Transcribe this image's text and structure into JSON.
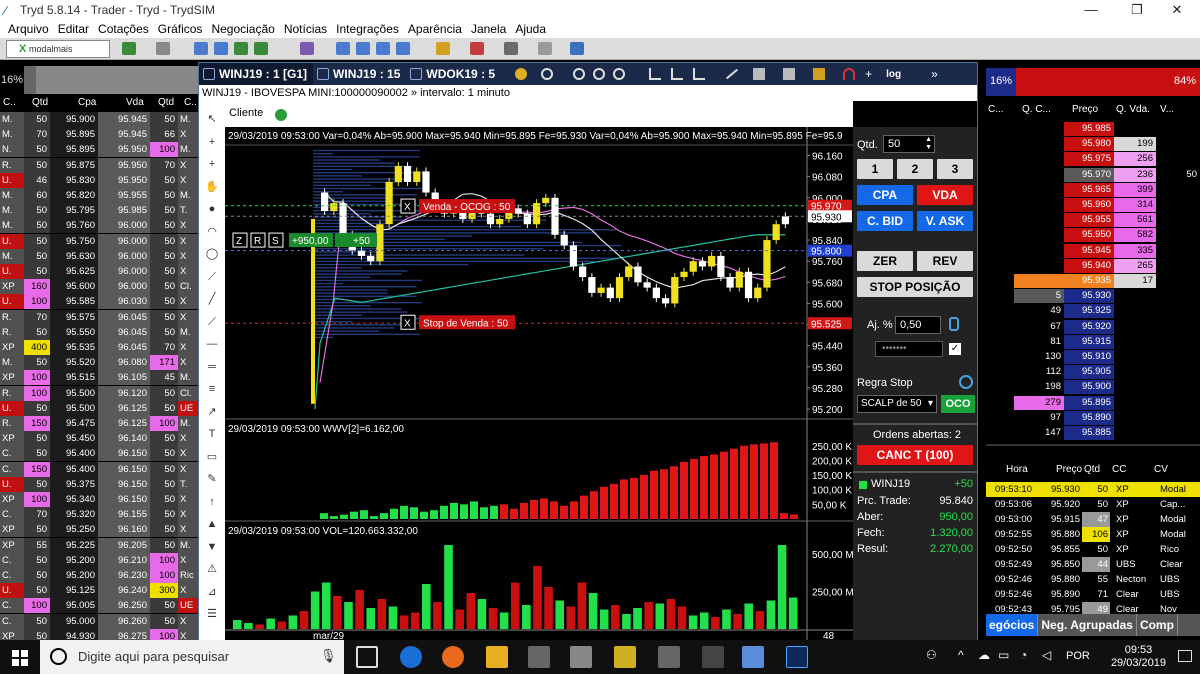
{
  "window": {
    "title": "Tryd 5.8.14 - Trader - Tryd - TrydSIM",
    "min": "—",
    "max": "❐",
    "close": "✕"
  },
  "menu": [
    "Arquivo",
    "Editar",
    "Cotações",
    "Gráficos",
    "Negociação",
    "Notícias",
    "Integrações",
    "Aparência",
    "Janela",
    "Ajuda"
  ],
  "toolbar": {
    "broker": "modalmais"
  },
  "left_book": {
    "pct": "16%",
    "headers": [
      "C..",
      "Qtd",
      "Cpa",
      "Vda",
      "Qtd",
      "C.."
    ],
    "rows": [
      [
        "M.",
        "50",
        "95.900",
        "95.945",
        "50",
        "M."
      ],
      [
        "M.",
        "70",
        "95.895",
        "95.945",
        "66",
        "X"
      ],
      [
        "N.",
        "50",
        "95.895",
        "95.950",
        "100",
        "M."
      ],
      [
        "R.",
        "50",
        "95.875",
        "95.950",
        "70",
        "X"
      ],
      [
        "U.",
        "46",
        "95.830",
        "95.950",
        "50",
        "X"
      ],
      [
        "M.",
        "60",
        "95.820",
        "95.955",
        "50",
        "M."
      ],
      [
        "M.",
        "50",
        "95.795",
        "95.985",
        "50",
        "T."
      ],
      [
        "M.",
        "50",
        "95.760",
        "96.000",
        "50",
        "X"
      ],
      [
        "U.",
        "50",
        "95.750",
        "96.000",
        "50",
        "X"
      ],
      [
        "M.",
        "50",
        "95.630",
        "96.000",
        "50",
        "X"
      ],
      [
        "U.",
        "50",
        "95.625",
        "96.000",
        "50",
        "X"
      ],
      [
        "XP",
        "160",
        "95.600",
        "96.000",
        "50",
        "Cl."
      ],
      [
        "U.",
        "100",
        "95.585",
        "96.030",
        "50",
        "X"
      ],
      [
        "R.",
        "70",
        "95.575",
        "96.045",
        "50",
        "X"
      ],
      [
        "R.",
        "50",
        "95.550",
        "96.045",
        "50",
        "M."
      ],
      [
        "XP",
        "400",
        "95.535",
        "96.045",
        "70",
        "X"
      ],
      [
        "M.",
        "50",
        "95.520",
        "96.080",
        "171",
        "X"
      ],
      [
        "XP",
        "100",
        "95.515",
        "96.105",
        "45",
        "M."
      ],
      [
        "R.",
        "100",
        "95.500",
        "96.120",
        "50",
        "Cl."
      ],
      [
        "U.",
        "50",
        "95.500",
        "96.125",
        "50",
        "UE"
      ],
      [
        "R.",
        "150",
        "95.475",
        "96.125",
        "100",
        "M."
      ],
      [
        "XP",
        "50",
        "95.450",
        "96.140",
        "50",
        "X"
      ],
      [
        "C.",
        "50",
        "95.400",
        "96.150",
        "50",
        "X"
      ],
      [
        "C.",
        "150",
        "95.400",
        "96.150",
        "50",
        "X"
      ],
      [
        "U.",
        "50",
        "95.375",
        "96.150",
        "50",
        "T."
      ],
      [
        "XP",
        "100",
        "95.340",
        "96.150",
        "50",
        "X"
      ],
      [
        "C.",
        "70",
        "95.320",
        "96.155",
        "50",
        "X"
      ],
      [
        "XP",
        "50",
        "95.250",
        "96.160",
        "50",
        "X"
      ],
      [
        "XP",
        "55",
        "95.225",
        "96.205",
        "50",
        "M."
      ],
      [
        "C.",
        "50",
        "95.200",
        "96.210",
        "100",
        "X"
      ],
      [
        "C.",
        "50",
        "95.200",
        "96.230",
        "100",
        "Ric"
      ],
      [
        "U.",
        "50",
        "95.125",
        "96.240",
        "300",
        "X"
      ],
      [
        "C.",
        "100",
        "95.005",
        "96.250",
        "50",
        "UE"
      ],
      [
        "C.",
        "50",
        "95.000",
        "96.260",
        "50",
        "X"
      ],
      [
        "XP",
        "50",
        "94.930",
        "96.275",
        "100",
        "X"
      ]
    ]
  },
  "chart_window": {
    "tabs": [
      "WINJ19 : 1 [G1]",
      "WINJ19 : 15",
      "WDOK19 : 5"
    ],
    "subtitle": "WINJ19 - IBOVESPA MINI:100000090002 » intervalo: 1 minuto",
    "client_label": "Cliente",
    "extra": "log"
  },
  "chart_data": [
    {
      "type": "candlestick",
      "info": "29/03/2019 09:53:00  Var=0,04%  Ab=95.900  Max=95.940  Min=95.895  Fe=95.930  Var=0,04%  Ab=95.900  Max=95.940  Min=95.895  Fe=95.9",
      "y_ticks": [
        "96.160",
        "96.080",
        "96.000",
        "95.920",
        "95.840",
        "95.760",
        "95.680",
        "95.600",
        "95.520",
        "95.440",
        "95.360",
        "95.280",
        "95.200"
      ],
      "ylim": [
        95.17,
        96.2
      ],
      "price_tags": [
        {
          "label": "95.970",
          "value": 95.97,
          "color": "#d41818"
        },
        {
          "label": "95.930",
          "value": 95.93,
          "color": "#ffffff"
        },
        {
          "label": "95.800",
          "value": 95.8,
          "color": "#1f3fd0"
        },
        {
          "label": "95.525",
          "value": 95.525,
          "color": "#d41818"
        }
      ],
      "orders": [
        {
          "label": "Venda - OCOG : 50",
          "value": 95.965
        },
        {
          "label": "Stop de Venda : 50",
          "value": 95.525
        }
      ],
      "position": {
        "label": "+950,00",
        "qty": "+50",
        "buttons": [
          "Z",
          "R",
          "S"
        ]
      },
      "close": [
        96.02,
        95.95,
        95.98,
        95.86,
        95.8,
        95.78,
        95.76,
        95.9,
        96.06,
        96.12,
        96.06,
        96.1,
        96.02,
        95.96,
        95.94,
        95.96,
        95.92,
        95.98,
        95.94,
        95.9,
        95.92,
        95.96,
        95.94,
        95.9,
        95.98,
        96.0,
        95.86,
        95.82,
        95.74,
        95.7,
        95.64,
        95.66,
        95.62,
        95.7,
        95.74,
        95.68,
        95.66,
        95.62,
        95.6,
        95.7,
        95.72,
        95.76,
        95.74,
        95.78,
        95.7,
        95.66,
        95.72,
        95.62,
        95.66,
        95.84,
        95.93
      ],
      "open": [
        95.95,
        95.98,
        95.86,
        95.8,
        95.78,
        95.76,
        95.9,
        96.06,
        96.12,
        96.06,
        96.1,
        96.02,
        95.96,
        95.94,
        95.96,
        95.92,
        95.98,
        95.94,
        95.9,
        95.92,
        95.96,
        95.94,
        95.9,
        95.98,
        96.0,
        95.86,
        95.82,
        95.74,
        95.7,
        95.64,
        95.66,
        95.62,
        95.7,
        95.74,
        95.68,
        95.66,
        95.62,
        95.6,
        95.7,
        95.72,
        95.76,
        95.74,
        95.78,
        95.7,
        95.66,
        95.72,
        95.62,
        95.66,
        95.84,
        95.9,
        95.9
      ]
    },
    {
      "type": "bar",
      "info": "29/03/2019 09:53:00  WWV[2]=6.162,00",
      "y_ticks": [
        "250,00 K",
        "200,00 K",
        "150,00 K",
        "100,00 K",
        "50,00 K"
      ],
      "ylim": [
        0,
        280
      ],
      "values": [
        20,
        10,
        15,
        25,
        30,
        10,
        20,
        35,
        45,
        40,
        25,
        30,
        45,
        55,
        50,
        60,
        40,
        45,
        50,
        35,
        55,
        65,
        70,
        60,
        45,
        60,
        80,
        95,
        110,
        120,
        135,
        140,
        150,
        165,
        170,
        180,
        195,
        205,
        215,
        220,
        230,
        240,
        250,
        255,
        258,
        262,
        -20,
        -15,
        -30,
        -18,
        -12,
        -25,
        -28,
        -22,
        -30,
        -35,
        -28,
        -30
      ],
      "color_green": "#22e04a",
      "color_red": "#e01616"
    },
    {
      "type": "bar",
      "info": "29/03/2019 09:53:00  VOL=120.663.332,00",
      "y_ticks": [
        "500,00 M",
        "250,00 M"
      ],
      "ylim": [
        0,
        600
      ],
      "values": [
        60,
        40,
        30,
        70,
        50,
        90,
        120,
        250,
        310,
        220,
        180,
        260,
        140,
        200,
        150,
        90,
        110,
        300,
        180,
        560,
        130,
        240,
        200,
        140,
        110,
        310,
        160,
        420,
        280,
        190,
        150,
        310,
        240,
        130,
        160,
        100,
        140,
        180,
        170,
        200,
        150,
        90,
        110,
        80,
        130,
        100,
        170,
        120,
        190,
        560,
        210
      ],
      "colors": [
        "g",
        "g",
        "r",
        "g",
        "r",
        "g",
        "r",
        "g",
        "g",
        "r",
        "g",
        "r",
        "g",
        "r",
        "g",
        "r",
        "r",
        "g",
        "r",
        "g",
        "r",
        "r",
        "g",
        "r",
        "g",
        "r",
        "g",
        "r",
        "r",
        "g",
        "r",
        "r",
        "g",
        "g",
        "r",
        "g",
        "g",
        "r",
        "g",
        "r",
        "r",
        "g",
        "g",
        "r",
        "g",
        "r",
        "g",
        "r",
        "g",
        "g",
        "g"
      ],
      "x_labels": [
        "mar/29",
        "48"
      ]
    }
  ],
  "order_panel": {
    "qtd_label": "Qtd.",
    "qtd_value": "50",
    "quick": [
      "1",
      "2",
      "3"
    ],
    "cpa": "CPA",
    "vda": "VDA",
    "cbid": "C. BID",
    "vask": "V. ASK",
    "zer": "ZER",
    "rev": "REV",
    "stop": "STOP POSIÇÃO",
    "aj_label": "Aj. %",
    "aj_value": "0,50",
    "password": "•••••••",
    "regra_label": "Regra Stop",
    "regra_value": "SCALP de 50",
    "oco": "OCO",
    "ordens_abertas": "Ordens abertas: 2",
    "canc": "CANC T (100)",
    "asset": "WINJ19",
    "asset_pos": "+50",
    "rows": [
      [
        "Prc. Trade:",
        "95.840"
      ],
      [
        "Aber:",
        "950,00"
      ],
      [
        "Fech:",
        "1.320,00"
      ],
      [
        "Resul:",
        "2.270,00"
      ]
    ]
  },
  "right_book": {
    "pct_left": "16%",
    "pct_right": "84%",
    "headers": [
      "C...",
      "Q. C...",
      "Preço",
      "Q. Vda.",
      "V..."
    ],
    "rows": [
      [
        "",
        "",
        "95.985",
        "",
        ""
      ],
      [
        "",
        "",
        "95.980",
        "199",
        ""
      ],
      [
        "",
        "",
        "95.975",
        "256",
        ""
      ],
      [
        "",
        "",
        "95.970",
        "236",
        "50"
      ],
      [
        "",
        "",
        "95.965",
        "399",
        ""
      ],
      [
        "",
        "",
        "95.960",
        "314",
        ""
      ],
      [
        "",
        "",
        "95.955",
        "561",
        ""
      ],
      [
        "",
        "",
        "95.950",
        "582",
        ""
      ],
      [
        "",
        "",
        "95.945",
        "335",
        ""
      ],
      [
        "",
        "",
        "95.940",
        "265",
        ""
      ],
      [
        "",
        "",
        "95.935",
        "17",
        ""
      ],
      [
        "",
        "5",
        "95.930",
        "",
        ""
      ],
      [
        "",
        "49",
        "95.925",
        "",
        ""
      ],
      [
        "",
        "67",
        "95.920",
        "",
        ""
      ],
      [
        "",
        "81",
        "95.915",
        "",
        ""
      ],
      [
        "",
        "130",
        "95.910",
        "",
        ""
      ],
      [
        "",
        "112",
        "95.905",
        "",
        ""
      ],
      [
        "",
        "198",
        "95.900",
        "",
        ""
      ],
      [
        "",
        "279",
        "95.895",
        "",
        ""
      ],
      [
        "",
        "97",
        "95.890",
        "",
        ""
      ],
      [
        "",
        "147",
        "95.885",
        "",
        ""
      ]
    ]
  },
  "trades": {
    "headers": [
      "Hora",
      "Preço",
      "Qtd",
      "CC",
      "CV"
    ],
    "rows": [
      [
        "09:53:10",
        "95.930",
        "50",
        "XP",
        "Modal"
      ],
      [
        "09:53:06",
        "95.920",
        "50",
        "XP",
        "Cap..."
      ],
      [
        "09:53:00",
        "95.915",
        "47",
        "XP",
        "Modal"
      ],
      [
        "09:52:55",
        "95.880",
        "106",
        "XP",
        "Modal"
      ],
      [
        "09:52:50",
        "95.855",
        "50",
        "XP",
        "Rico"
      ],
      [
        "09:52:49",
        "95.850",
        "44",
        "UBS",
        "Clear"
      ],
      [
        "09:52:46",
        "95.880",
        "55",
        "Necton",
        "UBS"
      ],
      [
        "09:52:46",
        "95.890",
        "71",
        "Clear",
        "UBS"
      ],
      [
        "09:52:43",
        "95.795",
        "49",
        "Clear",
        "Nov"
      ]
    ],
    "tabs": [
      "egócios",
      "Neg. Agrupadas",
      "Comp"
    ]
  },
  "taskbar": {
    "search": "Digite aqui para pesquisar",
    "lang": "POR",
    "time": "09:53",
    "date": "29/03/2019"
  }
}
